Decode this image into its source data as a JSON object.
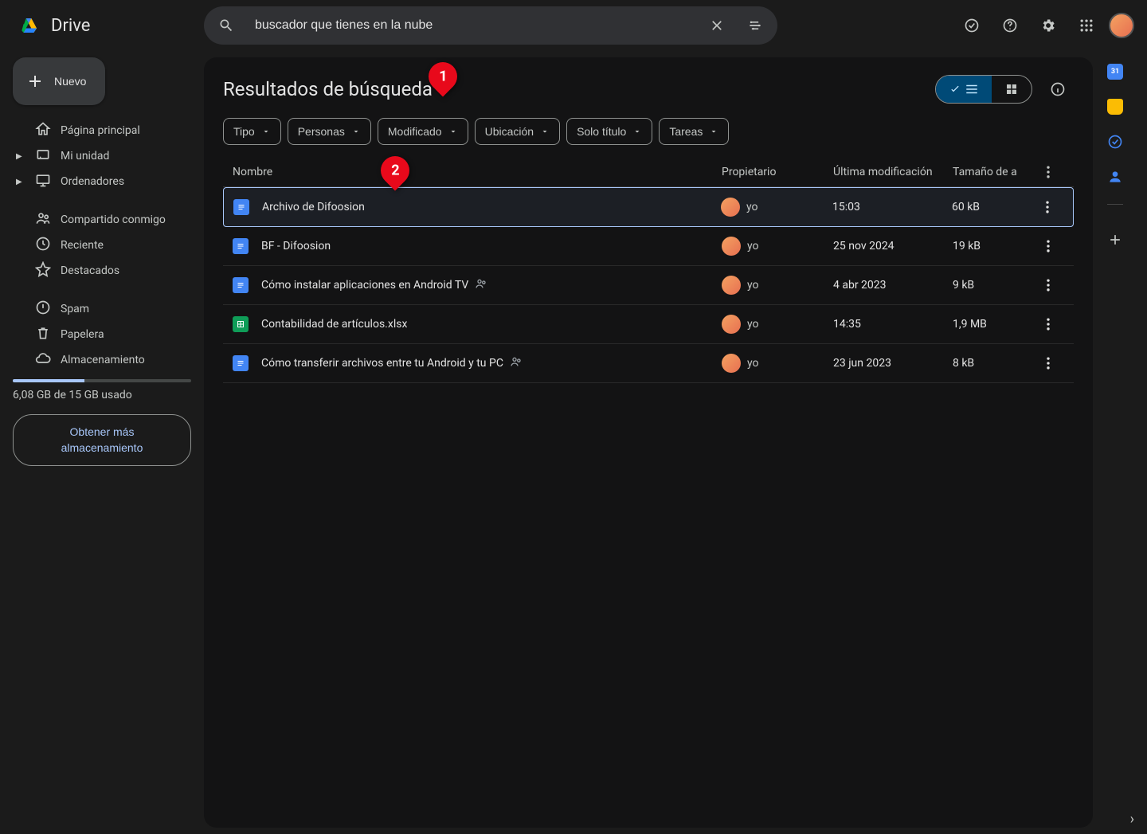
{
  "app": {
    "title": "Drive"
  },
  "search": {
    "value": "buscador que tienes en la nube"
  },
  "new_button": "Nuevo",
  "sidebar": {
    "items": [
      {
        "label": "Página principal"
      },
      {
        "label": "Mi unidad"
      },
      {
        "label": "Ordenadores"
      },
      {
        "label": "Compartido conmigo"
      },
      {
        "label": "Reciente"
      },
      {
        "label": "Destacados"
      },
      {
        "label": "Spam"
      },
      {
        "label": "Papelera"
      },
      {
        "label": "Almacenamiento"
      }
    ],
    "storage_text": "6,08 GB de 15 GB usado",
    "upgrade_button": "Obtener más almacenamiento"
  },
  "results": {
    "title": "Resultados de búsqueda",
    "filters": [
      {
        "label": "Tipo"
      },
      {
        "label": "Personas"
      },
      {
        "label": "Modificado"
      },
      {
        "label": "Ubicación"
      },
      {
        "label": "Solo título"
      },
      {
        "label": "Tareas"
      }
    ],
    "columns": {
      "name": "Nombre",
      "owner": "Propietario",
      "modified": "Última modificación",
      "size": "Tamaño de a"
    },
    "rows": [
      {
        "name": "Archivo de Difoosion",
        "owner": "yo",
        "modified": "15:03",
        "size": "60 kB",
        "type": "doc",
        "shared": false,
        "selected": true
      },
      {
        "name": "BF - Difoosion",
        "owner": "yo",
        "modified": "25 nov 2024",
        "size": "19 kB",
        "type": "doc",
        "shared": false,
        "selected": false
      },
      {
        "name": "Cómo instalar aplicaciones en Android TV",
        "owner": "yo",
        "modified": "4 abr 2023",
        "size": "9 kB",
        "type": "doc",
        "shared": true,
        "selected": false
      },
      {
        "name": "Contabilidad de artículos.xlsx",
        "owner": "yo",
        "modified": "14:35",
        "size": "1,9 MB",
        "type": "sheet",
        "shared": false,
        "selected": false
      },
      {
        "name": "Cómo transferir archivos entre tu Android y tu PC",
        "owner": "yo",
        "modified": "23 jun 2023",
        "size": "8 kB",
        "type": "doc",
        "shared": true,
        "selected": false
      }
    ]
  },
  "annotations": [
    {
      "num": "1"
    },
    {
      "num": "2"
    }
  ]
}
